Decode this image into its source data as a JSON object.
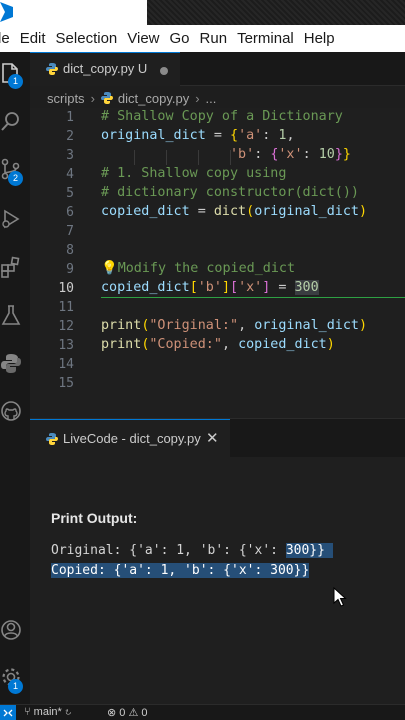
{
  "menu": [
    "le",
    "Edit",
    "Selection",
    "View",
    "Go",
    "Run",
    "Terminal",
    "Help"
  ],
  "activity": {
    "explorer_badge": "1",
    "scm_badge": "2",
    "settings_badge": "1"
  },
  "tab": {
    "label": "dict_copy.py U"
  },
  "breadcrumb": {
    "folder": "scripts",
    "file": "dict_copy.py",
    "more": "..."
  },
  "editor": {
    "line_numbers": [
      "1",
      "2",
      "3",
      "4",
      "5",
      "6",
      "7",
      "8",
      "9",
      "10",
      "11",
      "12",
      "13",
      "14",
      "15"
    ],
    "active_line": "10"
  },
  "panel": {
    "tab_label": "LiveCode - dict_copy.py",
    "close": "✕",
    "title": "Print Output:",
    "out1": "Original: {'a': 1, 'b': {'x': ",
    "out1_hl": "300}}",
    "out2": "Copied: {'a': 1, 'b': {'x': 300}}"
  },
  "statusbar": {
    "branch": "main*",
    "errors": "0",
    "warnings": "0"
  },
  "colors": {
    "accent": "#0078d4",
    "selection": "#264f78",
    "comment": "#6a9955",
    "string": "#ce9178"
  }
}
